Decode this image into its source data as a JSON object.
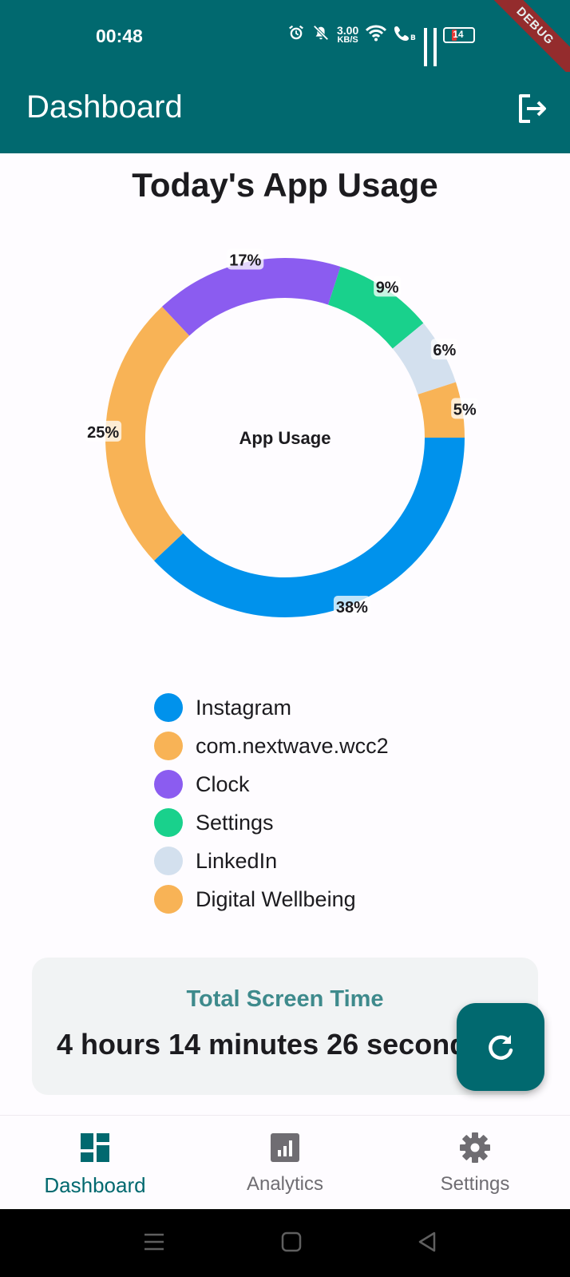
{
  "status_bar": {
    "time": "00:48",
    "net_speed_value": "3.00",
    "net_speed_unit": "KB/S",
    "battery": "14",
    "icons": [
      "alarm-icon",
      "mute-icon",
      "wifi-icon",
      "volte-call-icon",
      "signal-icon",
      "signal-icon",
      "battery-icon"
    ]
  },
  "debug_banner": "DEBUG",
  "app_bar": {
    "title": "Dashboard",
    "action_icon": "logout-icon"
  },
  "section_title": "Today's App Usage",
  "chart_data": {
    "type": "pie",
    "center_label": "App Usage",
    "slices": [
      {
        "name": "Instagram",
        "percent": 38,
        "label": "38%",
        "color": "#0092ec"
      },
      {
        "name": "com.nextwave.wcc2",
        "percent": 25,
        "label": "25%",
        "color": "#f8b356"
      },
      {
        "name": "Clock",
        "percent": 17,
        "label": "17%",
        "color": "#8b5cf0"
      },
      {
        "name": "Settings",
        "percent": 9,
        "label": "9%",
        "color": "#19d18c"
      },
      {
        "name": "LinkedIn",
        "percent": 6,
        "label": "6%",
        "color": "#d3e0ee"
      },
      {
        "name": "Digital Wellbeing",
        "percent": 5,
        "label": "5%",
        "color": "#f8b356"
      }
    ]
  },
  "legend": [
    {
      "label": "Instagram",
      "color": "#0092ec"
    },
    {
      "label": "com.nextwave.wcc2",
      "color": "#f8b356"
    },
    {
      "label": "Clock",
      "color": "#8b5cf0"
    },
    {
      "label": "Settings",
      "color": "#19d18c"
    },
    {
      "label": "LinkedIn",
      "color": "#d3e0ee"
    },
    {
      "label": "Digital Wellbeing",
      "color": "#f8b356"
    }
  ],
  "screen_time": {
    "title": "Total Screen Time",
    "value": "4 hours 14 minutes 26 seconds"
  },
  "fab": {
    "icon": "refresh-icon"
  },
  "bottom_nav": {
    "items": [
      {
        "label": "Dashboard",
        "icon": "dashboard-icon",
        "active": true
      },
      {
        "label": "Analytics",
        "icon": "analytics-icon",
        "active": false
      },
      {
        "label": "Settings",
        "icon": "settings-icon",
        "active": false
      }
    ]
  },
  "colors": {
    "primary": "#01696f",
    "title_accent": "#3e8a8c",
    "card_bg": "#f1f3f4"
  }
}
